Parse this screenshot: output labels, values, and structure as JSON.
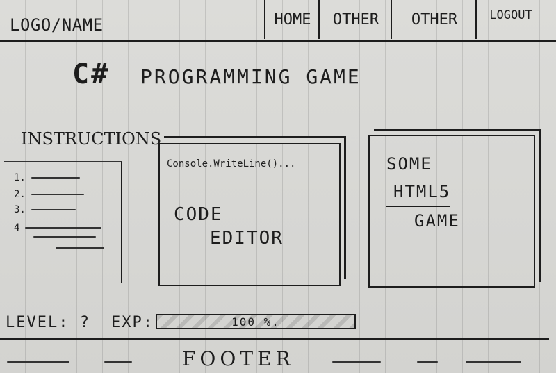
{
  "header": {
    "logo": "LOGO/NAME",
    "nav": [
      {
        "label": "HOME"
      },
      {
        "label": "OTHER"
      },
      {
        "label": "OTHER"
      }
    ],
    "logout": "LOGOUT"
  },
  "title": {
    "symbol": "C#",
    "text": "PROGRAMMING GAME"
  },
  "instructions": {
    "heading": "INSTRUCTIONS",
    "items": [
      "1.",
      "2.",
      "3.",
      "4"
    ]
  },
  "editor": {
    "code_line": "Console.WriteLine()...",
    "label_line1": "CODE",
    "label_line2": "EDITOR"
  },
  "game": {
    "line1": "SOME",
    "line2": "HTML5",
    "line3": "GAME"
  },
  "stats": {
    "level_label": "LEVEL: ?",
    "exp_label": "EXP:",
    "exp_text": "100 %.",
    "exp_progress": 1.0
  },
  "footer": {
    "text": "FOOTER"
  }
}
